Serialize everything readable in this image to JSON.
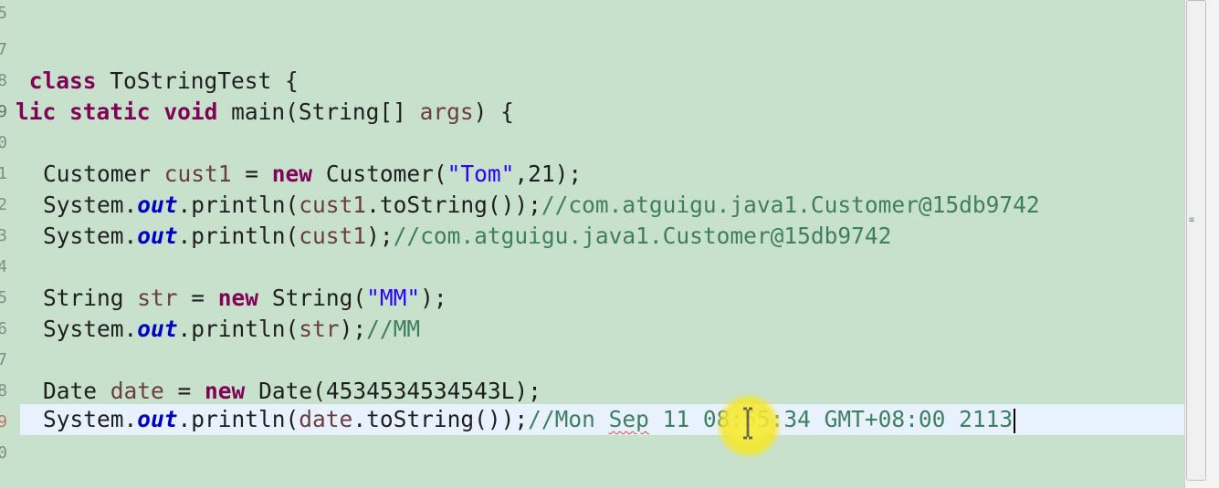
{
  "gutter": {
    "line_numbers": [
      "5",
      "7",
      "8",
      "9",
      "0",
      "1",
      "2",
      "3",
      "4",
      "5",
      "6",
      "7",
      "8",
      "9",
      "0"
    ]
  },
  "code": {
    "line_class": {
      "keyword": "class",
      "name": " ToStringTest {",
      "prefix": " "
    },
    "line_main": {
      "partial": "lic",
      "kw1": "static",
      "kw2": "void",
      "rest_a": " main(String[] ",
      "arg": "args",
      "rest_b": ") {"
    },
    "line_customer": {
      "type": "Customer ",
      "var": "cust1",
      "eq": " = ",
      "new": "new",
      "ctor": " Customer(",
      "str": "\"Tom\"",
      "tail": ",21);"
    },
    "line_print1": {
      "sys": "System.",
      "out": "out",
      "call": ".println(",
      "var": "cust1",
      "call2": ".toString());",
      "comment": "//com.atguigu.java1.Customer@15db9742"
    },
    "line_print2": {
      "sys": "System.",
      "out": "out",
      "call": ".println(",
      "var": "cust1",
      "tail": ");",
      "comment": "//com.atguigu.java1.Customer@15db9742"
    },
    "line_string": {
      "type": "String ",
      "var": "str",
      "eq": " = ",
      "new": "new",
      "ctor": " String(",
      "str": "\"MM\"",
      "tail": ");"
    },
    "line_print3": {
      "sys": "System.",
      "out": "out",
      "call": ".println(",
      "var": "str",
      "tail": ");",
      "comment": "//MM"
    },
    "line_date": {
      "type": "Date ",
      "var": "date",
      "eq": " = ",
      "new": "new",
      "ctor": " Date(4534534534543L);"
    },
    "line_print4": {
      "sys": "System.",
      "out": "out",
      "call": ".println(",
      "var": "date",
      "call2": ".toString());",
      "comment_a": "//Mon ",
      "comment_sep": "Sep",
      "comment_b": " 11 08:55:34 GMT+08:00 2113"
    }
  },
  "colors": {
    "editor_background": "#c7e1cc",
    "current_line": "#e8f2ff",
    "keyword": "#7f0055",
    "static_field": "#0000c0",
    "string": "#2a00ff",
    "comment": "#3f7f5f",
    "local_variable": "#6a3e3e",
    "cursor_highlight": "#f5e628"
  },
  "icons": {
    "scroll_grip": "scrollbar-grip-icon",
    "fold_marker": "fold-collapse-icon",
    "mouse_cursor": "i-beam-cursor-icon"
  }
}
